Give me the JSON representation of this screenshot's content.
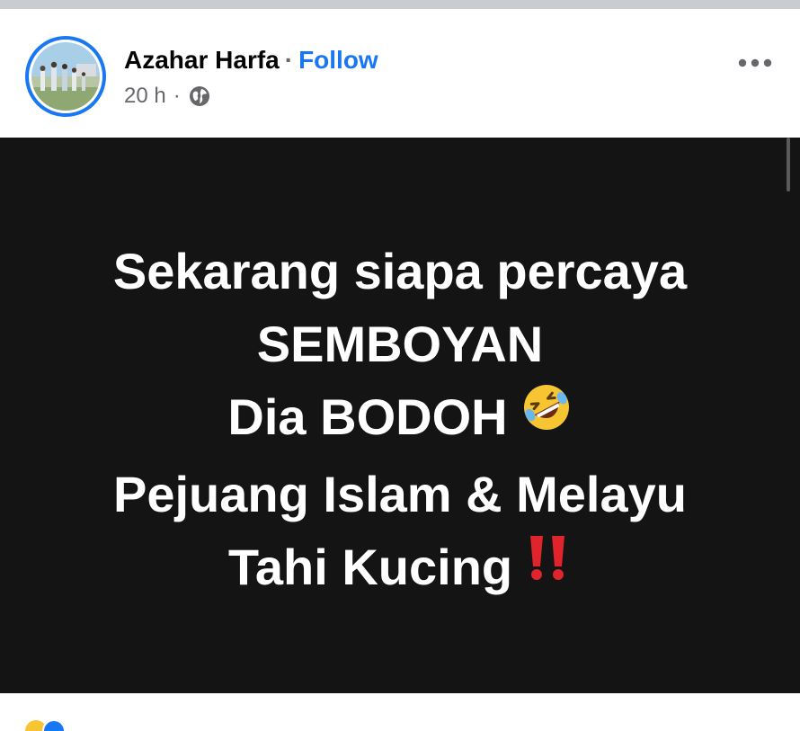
{
  "post": {
    "author": "Azahar Harfa",
    "separator": "·",
    "follow_label": "Follow",
    "timestamp": "20 h",
    "meta_separator": "·",
    "privacy_icon": "globe-icon",
    "more_icon": "more-horizontal-icon",
    "image_text_lines": [
      "Sekarang siapa percaya",
      "SEMBOYAN",
      "Dia BODOH",
      "Pejuang Islam & Melayu",
      "Tahi Kucing"
    ],
    "line_emojis": {
      "line3": "rolling-on-floor-laughing-emoji",
      "line5": "double-exclamation-emoji"
    }
  },
  "colors": {
    "accent": "#1877f2",
    "image_background": "#141414",
    "top_band": "#c9ccd1"
  }
}
